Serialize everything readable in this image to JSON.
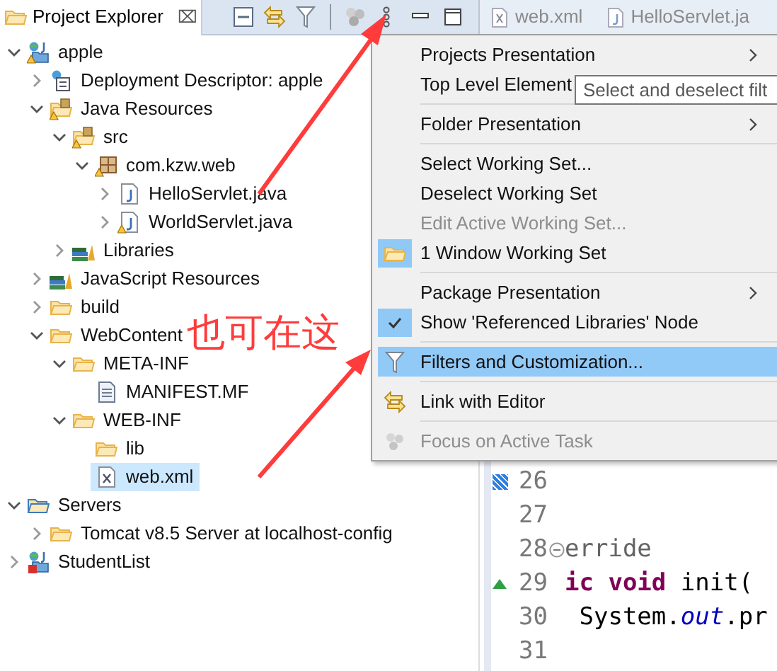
{
  "explorer": {
    "title": "Project Explorer",
    "close": "⌧"
  },
  "tree": [
    {
      "label": "apple",
      "kind": "web-project",
      "expanded": true,
      "selected": false,
      "children": [
        {
          "label": "Deployment Descriptor: apple",
          "kind": "descriptor",
          "expanded": false,
          "selected": false
        },
        {
          "label": "Java Resources",
          "kind": "java-resources",
          "expanded": true,
          "selected": false,
          "children": [
            {
              "label": "src",
              "kind": "source-folder",
              "expanded": true,
              "selected": false,
              "children": [
                {
                  "label": "com.kzw.web",
                  "kind": "package",
                  "expanded": true,
                  "selected": false,
                  "children": [
                    {
                      "label": "HelloServlet.java",
                      "kind": "java",
                      "expanded": false,
                      "selected": false
                    },
                    {
                      "label": "WorldServlet.java",
                      "kind": "java-warning",
                      "expanded": false,
                      "selected": false
                    }
                  ]
                }
              ]
            },
            {
              "label": "Libraries",
              "kind": "library",
              "expanded": false,
              "selected": false
            }
          ]
        },
        {
          "label": "JavaScript Resources",
          "kind": "library",
          "expanded": false,
          "selected": false
        },
        {
          "label": "build",
          "kind": "folder",
          "expanded": false,
          "selected": false
        },
        {
          "label": "WebContent",
          "kind": "folder",
          "expanded": true,
          "selected": false,
          "children": [
            {
              "label": "META-INF",
              "kind": "folder",
              "expanded": true,
              "selected": false,
              "children": [
                {
                  "label": "MANIFEST.MF",
                  "kind": "text-file",
                  "selected": false
                }
              ]
            },
            {
              "label": "WEB-INF",
              "kind": "folder",
              "expanded": true,
              "selected": false,
              "children": [
                {
                  "label": "lib",
                  "kind": "folder",
                  "selected": false
                },
                {
                  "label": "web.xml",
                  "kind": "xml",
                  "selected": true
                }
              ]
            }
          ]
        }
      ]
    },
    {
      "label": "Servers",
      "kind": "servers",
      "expanded": true,
      "selected": false,
      "children": [
        {
          "label": "Tomcat v8.5 Server at localhost-config",
          "kind": "folder",
          "expanded": false,
          "selected": false
        }
      ]
    },
    {
      "label": "StudentList",
      "kind": "web-project-error",
      "expanded": false,
      "selected": false
    }
  ],
  "editor_tabs": [
    {
      "label": "web.xml",
      "kind": "xml"
    },
    {
      "label": "HelloServlet.ja",
      "kind": "java"
    }
  ],
  "menu": [
    {
      "label": "Projects Presentation",
      "kind": "submenu",
      "disabled": false,
      "selected": false
    },
    {
      "label": "Top Level Element",
      "kind": "plain",
      "disabled": false,
      "selected": false
    },
    {
      "kind": "separator"
    },
    {
      "label": "Folder Presentation",
      "kind": "submenu",
      "disabled": false,
      "selected": false
    },
    {
      "kind": "separator"
    },
    {
      "label": "Select Working Set...",
      "kind": "plain",
      "disabled": false,
      "selected": false
    },
    {
      "label": "Deselect Working Set",
      "kind": "plain",
      "disabled": false,
      "selected": false
    },
    {
      "label": "Edit Active Working Set...",
      "kind": "plain",
      "disabled": true,
      "selected": false
    },
    {
      "label": "1 Window Working Set",
      "kind": "working-set",
      "checked": true,
      "disabled": false,
      "selected": false
    },
    {
      "kind": "separator"
    },
    {
      "label": "Package Presentation",
      "kind": "submenu",
      "disabled": false,
      "selected": false
    },
    {
      "label": "Show 'Referenced Libraries' Node",
      "kind": "check",
      "checked": true,
      "disabled": false,
      "selected": false
    },
    {
      "kind": "separator"
    },
    {
      "label": "Filters and Customization...",
      "kind": "filters",
      "disabled": false,
      "selected": true
    },
    {
      "kind": "separator"
    },
    {
      "label": "Link with Editor",
      "kind": "link",
      "disabled": false,
      "selected": false
    },
    {
      "kind": "separator"
    },
    {
      "label": "Focus on Active Task",
      "kind": "focus",
      "disabled": true,
      "selected": false
    }
  ],
  "tooltip": "Select and deselect filt",
  "code_lines": [
    {
      "number": "26",
      "bookmark": true
    },
    {
      "number": "27"
    },
    {
      "number": "28",
      "fold": true,
      "segments": [
        {
          "text": "erride",
          "kind": "annotation"
        }
      ]
    },
    {
      "number": "29",
      "override": true,
      "segments": [
        {
          "text": "ic void",
          "kind": "keyword"
        },
        {
          "text": " init(",
          "kind": "plain"
        }
      ]
    },
    {
      "number": "30",
      "segments": [
        {
          "text": " System.",
          "kind": "plain"
        },
        {
          "text": "out",
          "kind": "field"
        },
        {
          "text": ".pr",
          "kind": "plain"
        }
      ]
    },
    {
      "number": "31"
    }
  ],
  "annotation": "也可在这"
}
